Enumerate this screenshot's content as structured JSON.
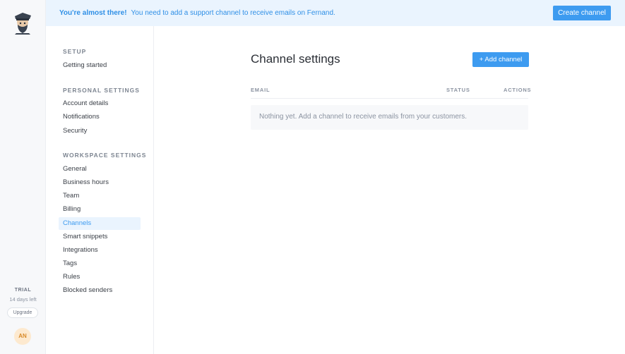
{
  "banner": {
    "headline": "You're almost there!",
    "message": "You need to add a support channel to receive emails on Fernand.",
    "cta_label": "Create channel"
  },
  "rail": {
    "trial_label": "TRIAL",
    "days_left": "14 days left",
    "upgrade_label": "Upgrade",
    "avatar_initials": "AN",
    "logo_icon": "fernand-mascot-logo"
  },
  "nav": {
    "sections": [
      {
        "title": "SETUP",
        "items": [
          "Getting started"
        ]
      },
      {
        "title": "PERSONAL SETTINGS",
        "items": [
          "Account details",
          "Notifications",
          "Security"
        ]
      },
      {
        "title": "WORKSPACE SETTINGS",
        "items": [
          "General",
          "Business hours",
          "Team",
          "Billing",
          "Channels",
          "Smart snippets",
          "Integrations",
          "Tags",
          "Rules",
          "Blocked senders"
        ]
      }
    ],
    "active_item": "Channels"
  },
  "main": {
    "title": "Channel settings",
    "add_button_label": "+ Add channel",
    "columns": [
      "EMAIL",
      "STATUS",
      "ACTIONS"
    ],
    "empty_message": "Nothing yet. Add a channel to receive emails from your customers."
  },
  "colors": {
    "accent": "#3d9bf0",
    "banner_bg": "#eaf4fe",
    "avatar_bg": "#fde9cf"
  }
}
